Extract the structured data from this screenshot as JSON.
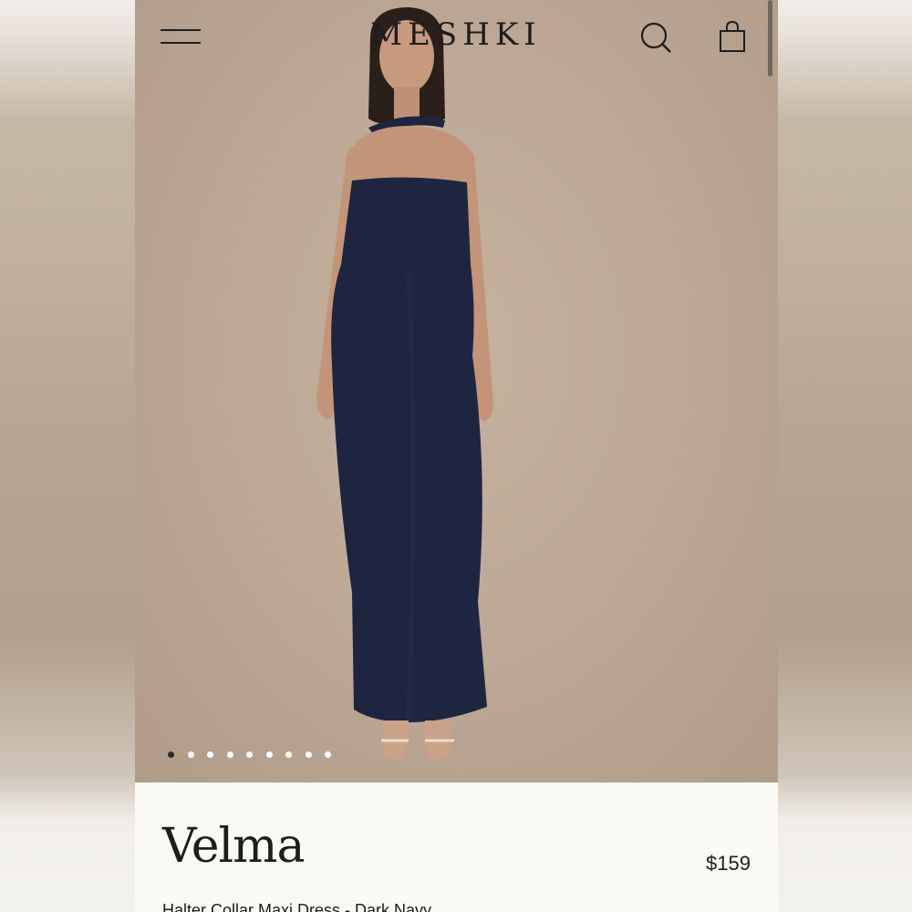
{
  "header": {
    "brand": "MESHKI",
    "menu_icon": "hamburger-menu-icon",
    "search_icon": "search-icon",
    "bag_icon": "shopping-bag-icon"
  },
  "gallery": {
    "image_count": 9,
    "active_index": 0,
    "background_color": "#bda995",
    "dress_color": "#1e2540"
  },
  "product": {
    "name": "Velma",
    "price": "$159",
    "subtitle": "Halter Collar Maxi Dress - Dark Navy"
  }
}
